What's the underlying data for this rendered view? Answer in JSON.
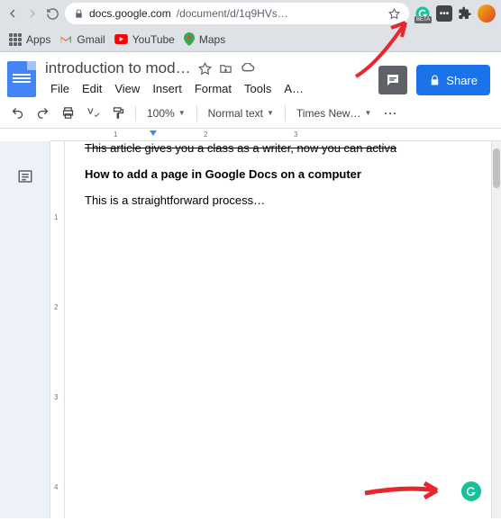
{
  "browser": {
    "url_host": "docs.google.com",
    "url_path": "/document/d/1q9HVs…",
    "bookmarks": {
      "apps": "Apps",
      "gmail": "Gmail",
      "youtube": "YouTube",
      "maps": "Maps"
    },
    "beta_badge": "BETA"
  },
  "docs": {
    "title": "introduction to mod…",
    "menus": {
      "file": "File",
      "edit": "Edit",
      "view": "View",
      "insert": "Insert",
      "format": "Format",
      "tools": "Tools",
      "addons": "A…"
    },
    "share_label": "Share",
    "toolbar": {
      "zoom": "100%",
      "style": "Normal text",
      "font": "Times New…",
      "more": "···"
    }
  },
  "ruler": {
    "marks": [
      "1",
      "2",
      "3"
    ]
  },
  "vruler": {
    "marks": [
      "1",
      "2",
      "3",
      "4"
    ]
  },
  "document": {
    "line0": "This article gives you a class as a writer, now you can activa",
    "line1": "How to add a page in Google Docs on a computer",
    "line2": "This is a straightforward process…"
  }
}
